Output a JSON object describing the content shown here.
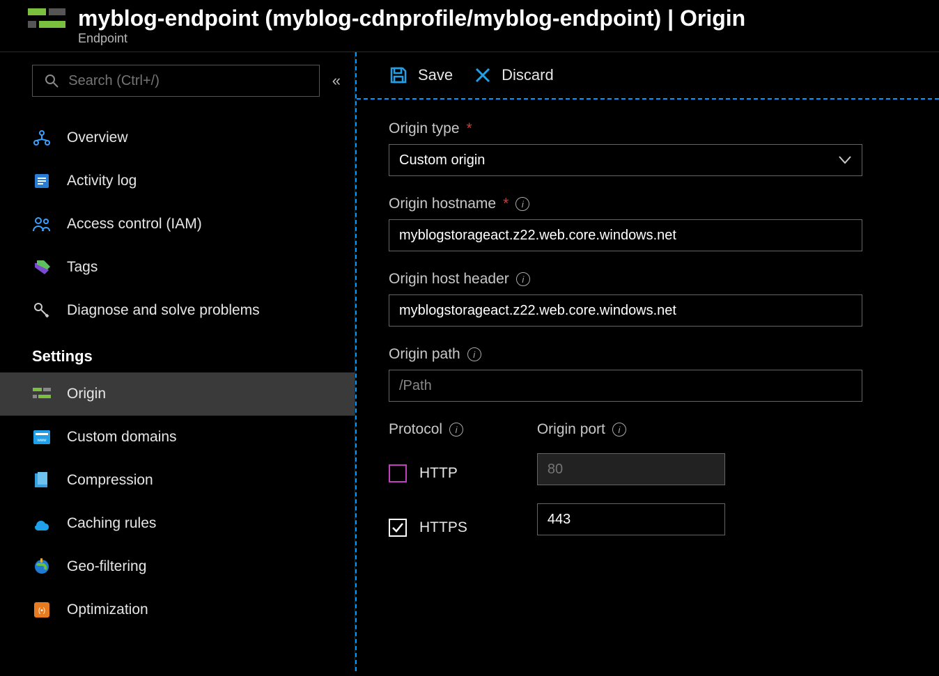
{
  "header": {
    "title": "myblog-endpoint (myblog-cdnprofile/myblog-endpoint) | Origin",
    "subtitle": "Endpoint"
  },
  "search": {
    "placeholder": "Search (Ctrl+/)"
  },
  "nav": {
    "overview": "Overview",
    "activityLog": "Activity log",
    "accessControl": "Access control (IAM)",
    "tags": "Tags",
    "diagnose": "Diagnose and solve problems",
    "settingsHeader": "Settings",
    "origin": "Origin",
    "customDomains": "Custom domains",
    "compression": "Compression",
    "cachingRules": "Caching rules",
    "geoFiltering": "Geo-filtering",
    "optimization": "Optimization"
  },
  "toolbar": {
    "save": "Save",
    "discard": "Discard"
  },
  "form": {
    "originTypeLabel": "Origin type",
    "originTypeValue": "Custom origin",
    "originHostnameLabel": "Origin hostname",
    "originHostnameValue": "myblogstorageact.z22.web.core.windows.net",
    "originHostHeaderLabel": "Origin host header",
    "originHostHeaderValue": "myblogstorageact.z22.web.core.windows.net",
    "originPathLabel": "Origin path",
    "originPathPlaceholder": "/Path",
    "protocolLabel": "Protocol",
    "originPortLabel": "Origin port",
    "http": "HTTP",
    "https": "HTTPS",
    "httpPort": "80",
    "httpsPort": "443"
  }
}
